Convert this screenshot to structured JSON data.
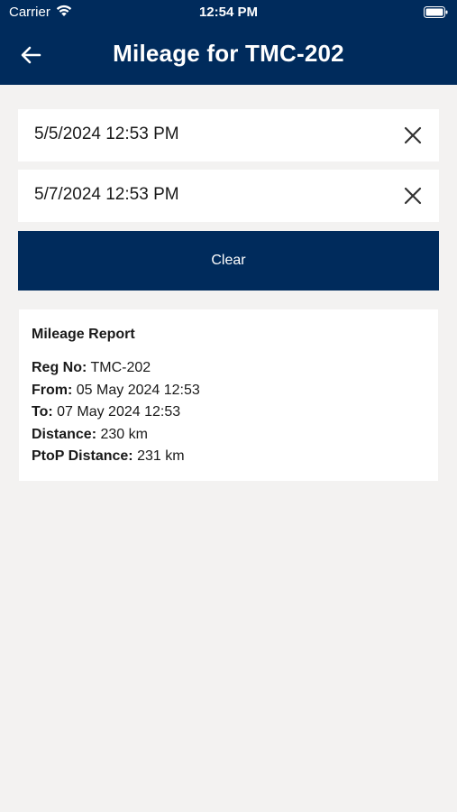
{
  "status_bar": {
    "carrier": "Carrier",
    "time": "12:54 PM"
  },
  "header": {
    "title": "Mileage for TMC-202",
    "background_color": "#002b5c"
  },
  "filters": {
    "from_date": "5/5/2024 12:53 PM",
    "to_date": "5/7/2024 12:53 PM",
    "clear_label": "Clear"
  },
  "report": {
    "title": "Mileage Report",
    "rows": [
      {
        "label": "Reg No:",
        "value": "TMC-202"
      },
      {
        "label": "From:",
        "value": "05 May 2024 12:53"
      },
      {
        "label": "To:",
        "value": "07 May 2024 12:53"
      },
      {
        "label": "Distance:",
        "value": "230 km"
      },
      {
        "label": "PtoP Distance:",
        "value": "231 km"
      }
    ]
  },
  "icons": {
    "back": "arrow-left-icon",
    "clear_field": "close-icon",
    "wifi": "wifi-icon",
    "battery": "battery-icon"
  }
}
